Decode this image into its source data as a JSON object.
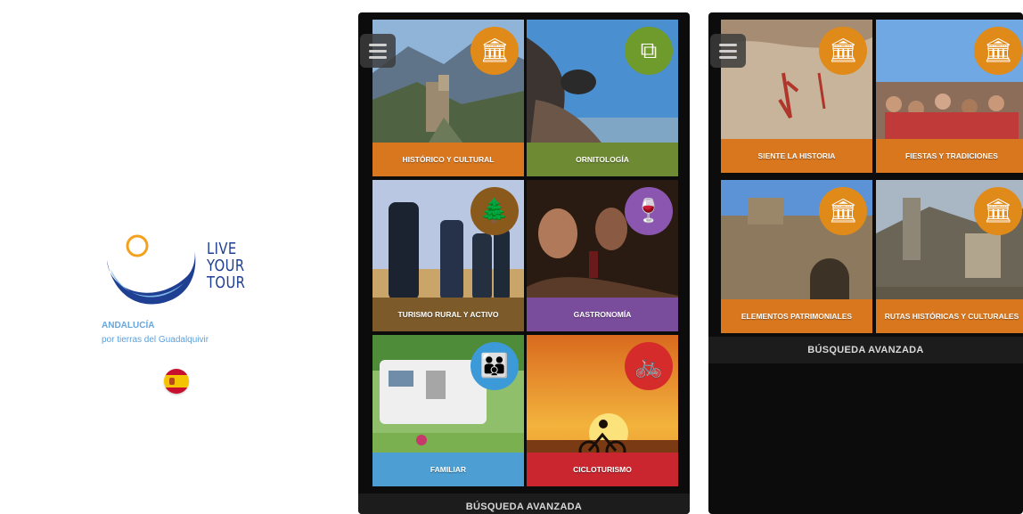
{
  "splash": {
    "logo_line1": "LIVE",
    "logo_line2": "YOUR",
    "logo_line3": "TOUR",
    "region": "ANDALUCÍA",
    "tagline": "por tierras del Guadalquivir",
    "language_flag": "spain-flag-icon"
  },
  "screen1": {
    "tiles": [
      {
        "label": "HISTÓRICO Y CULTURAL",
        "icon": "monument-icon",
        "badge_color": "#e08a1a",
        "label_color": "#d9771f"
      },
      {
        "label": "ORNITOLOGÍA",
        "icon": "binoculars-icon",
        "badge_color": "#6f9a2c",
        "label_color": "#6e8a33"
      },
      {
        "label": "TURISMO RURAL Y ACTIVO",
        "icon": "trees-icon",
        "badge_color": "#8a5a1c",
        "label_color": "#7c5a2a"
      },
      {
        "label": "GASTRONOMÍA",
        "icon": "wine-icon",
        "badge_color": "#8a56b0",
        "label_color": "#7a4c9c"
      },
      {
        "label": "FAMILIAR",
        "icon": "family-icon",
        "badge_color": "#3d9ad8",
        "label_color": "#4d9ed2"
      },
      {
        "label": "CICLOTURISMO",
        "icon": "bicycle-icon",
        "badge_color": "#d52b2b",
        "label_color": "#c9262f"
      }
    ],
    "search_label": "BÚSQUEDA AVANZADA"
  },
  "screen2": {
    "tiles": [
      {
        "label": "SIENTE LA HISTORIA",
        "icon": "monument-icon",
        "badge_color": "#e08a1a",
        "label_color": "#d9771f"
      },
      {
        "label": "FIESTAS Y TRADICIONES",
        "icon": "monument-icon",
        "badge_color": "#e08a1a",
        "label_color": "#d9771f"
      },
      {
        "label": "ELEMENTOS PATRIMONIALES",
        "icon": "monument-icon",
        "badge_color": "#e08a1a",
        "label_color": "#d9771f"
      },
      {
        "label": "RUTAS HISTÓRICAS Y CULTURALES",
        "icon": "monument-icon",
        "badge_color": "#e08a1a",
        "label_color": "#d9771f"
      }
    ],
    "search_label": "BÚSQUEDA AVANZADA"
  }
}
